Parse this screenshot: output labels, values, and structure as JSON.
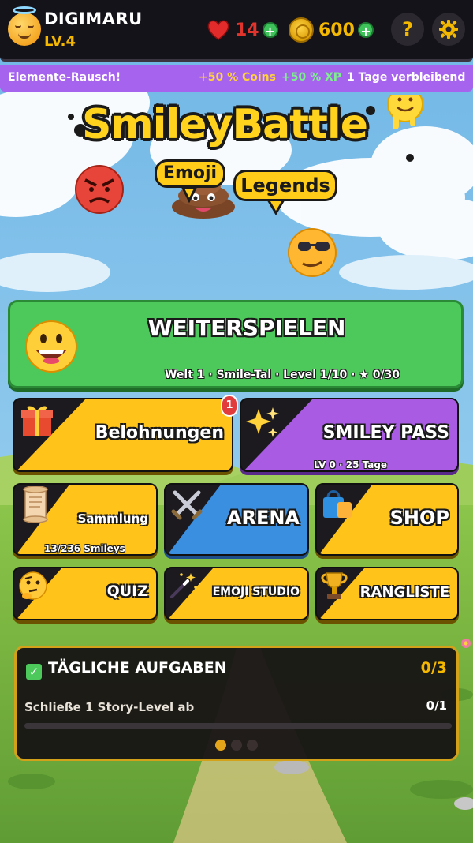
{
  "player": {
    "name": "DIGIMARU",
    "level": "LV.4",
    "hearts": "14",
    "coins": "600"
  },
  "event": {
    "title": "Elemente-Rausch!",
    "coins_bonus": "+50 % Coins",
    "xp_bonus": "+50 % XP",
    "time_left": "1 Tage verbleibend"
  },
  "logo": {
    "title": "SmileyBattle",
    "word1": "Emoji",
    "word2": "Legends"
  },
  "continue": {
    "title": "WEITERSPIELEN",
    "subtitle": "Welt 1 · Smile-Tal · Level 1/10 · ★ 0/30"
  },
  "tiles": {
    "rewards": {
      "label": "Belohnungen",
      "badge": "1"
    },
    "pass": {
      "label": "SMILEY PASS",
      "sub": "LV 0 · 25 Tage"
    },
    "collection": {
      "label": "Sammlung",
      "sub": "13/236 Smileys"
    },
    "arena": {
      "label": "ARENA"
    },
    "shop": {
      "label": "SHOP"
    },
    "quiz": {
      "label": "QUIZ"
    },
    "studio": {
      "label": "EMOJI STUDIO"
    },
    "leaderboard": {
      "label": "RANGLISTE"
    }
  },
  "daily": {
    "title": "TÄGLICHE AUFGABEN",
    "count": "0/3",
    "task": "Schließe 1 Story-Level ab",
    "task_count": "0/1",
    "task_progress": 0,
    "page_total": 3,
    "page_active": 1
  },
  "colors": {
    "tile_yellow": "#ffc31a",
    "tile_purple": "#a95be3",
    "tile_blue": "#3a8fe0",
    "continue_green": "#4cc95a",
    "event_purple": "#a663ee"
  },
  "icons": [
    "heart-icon",
    "coin-icon",
    "help-icon",
    "gear-icon",
    "gift-icon",
    "sparkle-icon",
    "scroll-icon",
    "swords-icon",
    "shopping-bag-icon",
    "thinking-face-icon",
    "magic-wand-icon",
    "trophy-icon",
    "check-icon"
  ]
}
